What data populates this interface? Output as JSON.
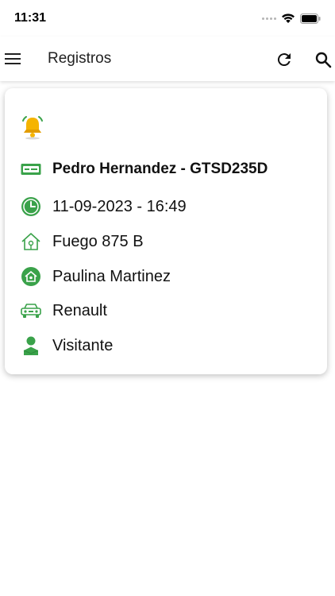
{
  "status": {
    "time": "11:31"
  },
  "appbar": {
    "title": "Registros"
  },
  "card": {
    "name_plate": "Pedro Hernandez - GTSD235D",
    "datetime": "11-09-2023 - 16:49",
    "address": "Fuego 875 B",
    "resident": "Paulina Martinez",
    "vehicle": "Renault",
    "visitor_type": "Visitante"
  },
  "colors": {
    "accent_green": "#3aa24a",
    "bell_yellow": "#f5b400"
  }
}
